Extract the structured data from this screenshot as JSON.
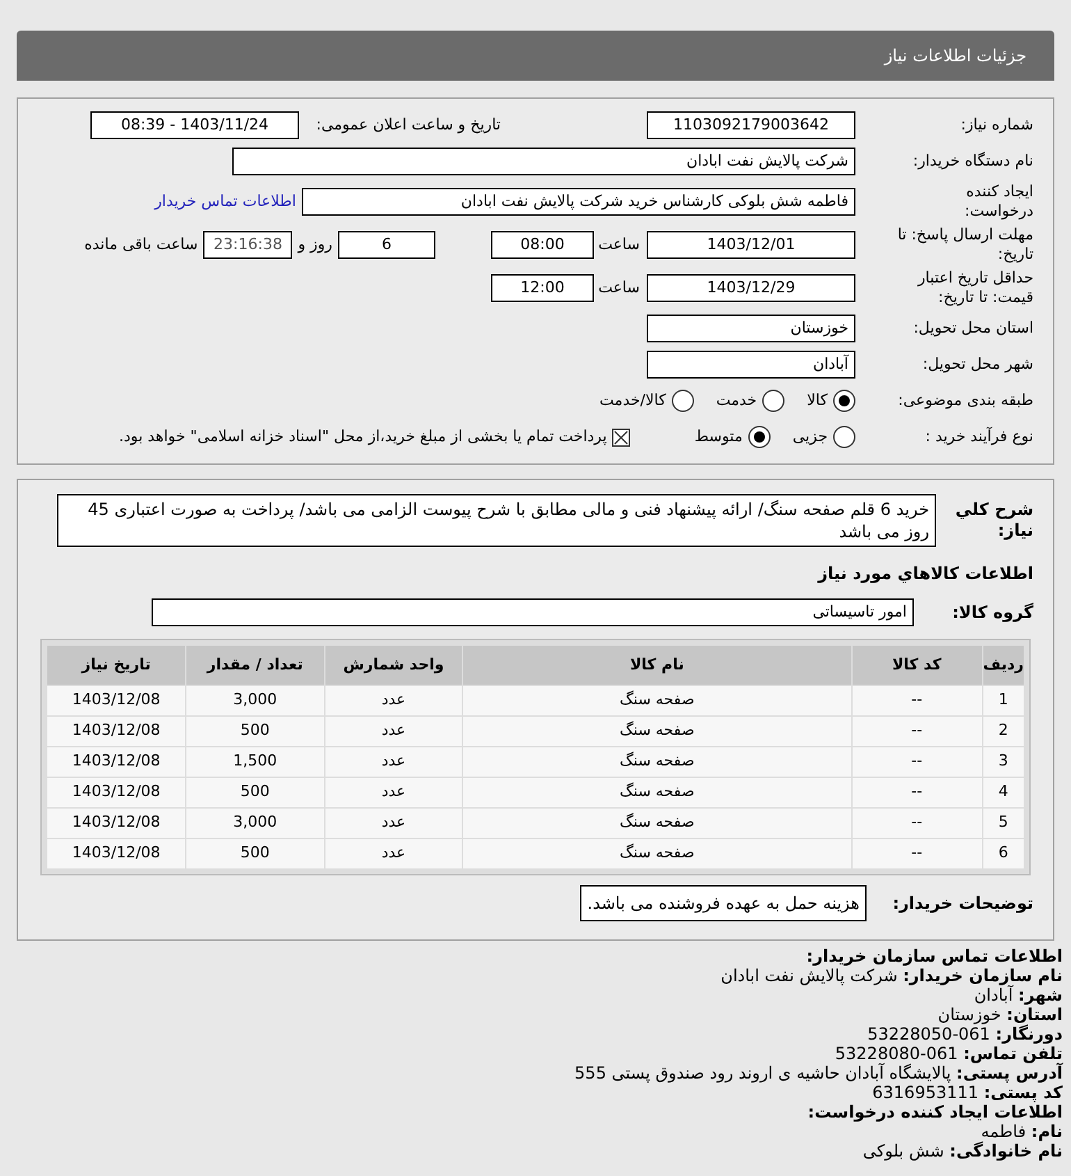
{
  "header": {
    "title": "جزئیات اطلاعات نیاز"
  },
  "need_number": {
    "label": "شماره نیاز:",
    "value": "1103092179003642"
  },
  "announce": {
    "label": "تاریخ و ساعت اعلان عمومی:",
    "value": "1403/11/24 - 08:39"
  },
  "buyer_org": {
    "label": "نام دستگاه خریدار:",
    "value": "شرکت پالایش نفت ابادان"
  },
  "requester": {
    "label": "ایجاد کننده درخواست:",
    "value": "فاطمه شش بلوکی کارشناس خرید شرکت پالایش نفت ابادان",
    "link": "اطلاعات تماس خریدار"
  },
  "reply_deadline": {
    "label": "مهلت ارسال پاسخ: تا تاریخ:",
    "date": "1403/12/01",
    "time_label": "ساعت",
    "time": "08:00",
    "days": "6",
    "days_label": "روز و",
    "remaining": "23:16:38",
    "remaining_label": "ساعت باقی مانده"
  },
  "price_validity": {
    "label": "حداقل تاریخ اعتبار قیمت: تا تاریخ:",
    "date": "1403/12/29",
    "time_label": "ساعت",
    "time": "12:00"
  },
  "province": {
    "label": "استان محل تحویل:",
    "value": "خوزستان"
  },
  "city": {
    "label": "شهر محل تحویل:",
    "value": "آبادان"
  },
  "category": {
    "label": "طبقه بندی موضوعی:",
    "options": [
      {
        "label": "کالا",
        "selected": true
      },
      {
        "label": "خدمت",
        "selected": false
      },
      {
        "label": "کالا/خدمت",
        "selected": false
      }
    ]
  },
  "process": {
    "label": "نوع فرآیند خرید :",
    "options": [
      {
        "label": "جزیی",
        "selected": false
      },
      {
        "label": "متوسط",
        "selected": true
      }
    ],
    "payment": {
      "label": "پرداخت تمام یا بخشی از مبلغ خرید،از محل \"اسناد خزانه اسلامی\" خواهد بود.",
      "checked": true
    }
  },
  "description": {
    "label": "شرح كلي نياز:",
    "value": "خرید 6 قلم صفحه سنگ/ ارائه پیشنهاد فنی و مالی مطابق با شرح پیوست الزامی می باشد/ پرداخت به صورت اعتباری 45 روز می باشد"
  },
  "goods_heading": "اطلاعات كالاهاي مورد نياز",
  "goods_group": {
    "label": "گروه کالا:",
    "value": "امور تاسیساتی"
  },
  "table": {
    "columns": [
      "ردیف",
      "کد کالا",
      "نام کالا",
      "واحد شمارش",
      "تعداد / مقدار",
      "تاریخ نیاز"
    ],
    "rows": [
      [
        "1",
        "--",
        "صفحه سنگ",
        "عدد",
        "3,000",
        "1403/12/08"
      ],
      [
        "2",
        "--",
        "صفحه سنگ",
        "عدد",
        "500",
        "1403/12/08"
      ],
      [
        "3",
        "--",
        "صفحه سنگ",
        "عدد",
        "1,500",
        "1403/12/08"
      ],
      [
        "4",
        "--",
        "صفحه سنگ",
        "عدد",
        "500",
        "1403/12/08"
      ],
      [
        "5",
        "--",
        "صفحه سنگ",
        "عدد",
        "3,000",
        "1403/12/08"
      ],
      [
        "6",
        "--",
        "صفحه سنگ",
        "عدد",
        "500",
        "1403/12/08"
      ]
    ]
  },
  "buyer_notes": {
    "label": "توضیحات خریدار:",
    "value": "هزینه حمل به عهده فروشنده می باشد."
  },
  "contact": [
    {
      "kind": "heading",
      "label": "اطلاعات تماس سازمان خریدار:"
    },
    {
      "kind": "field",
      "label": "نام سازمان خریدار:",
      "value": "شرکت پالایش نفت ابادان"
    },
    {
      "kind": "field",
      "label": "شهر:",
      "value": "آبادان"
    },
    {
      "kind": "field",
      "label": "استان:",
      "value": "خوزستان"
    },
    {
      "kind": "field",
      "label": "دورنگار:",
      "value": "061-53228050"
    },
    {
      "kind": "field",
      "label": "تلفن تماس:",
      "value": "061-53228080"
    },
    {
      "kind": "field",
      "label": "آدرس پستی:",
      "value": "پالایشگاه آبادان حاشیه ی اروند رود صندوق پستی 555"
    },
    {
      "kind": "field",
      "label": "کد پستی:",
      "value": "6316953111"
    },
    {
      "kind": "heading",
      "label": "اطلاعات ایجاد کننده درخواست:"
    },
    {
      "kind": "field",
      "label": "نام:",
      "value": "فاطمه"
    },
    {
      "kind": "field",
      "label": "نام خانوادگی:",
      "value": "شش بلوکی"
    }
  ]
}
